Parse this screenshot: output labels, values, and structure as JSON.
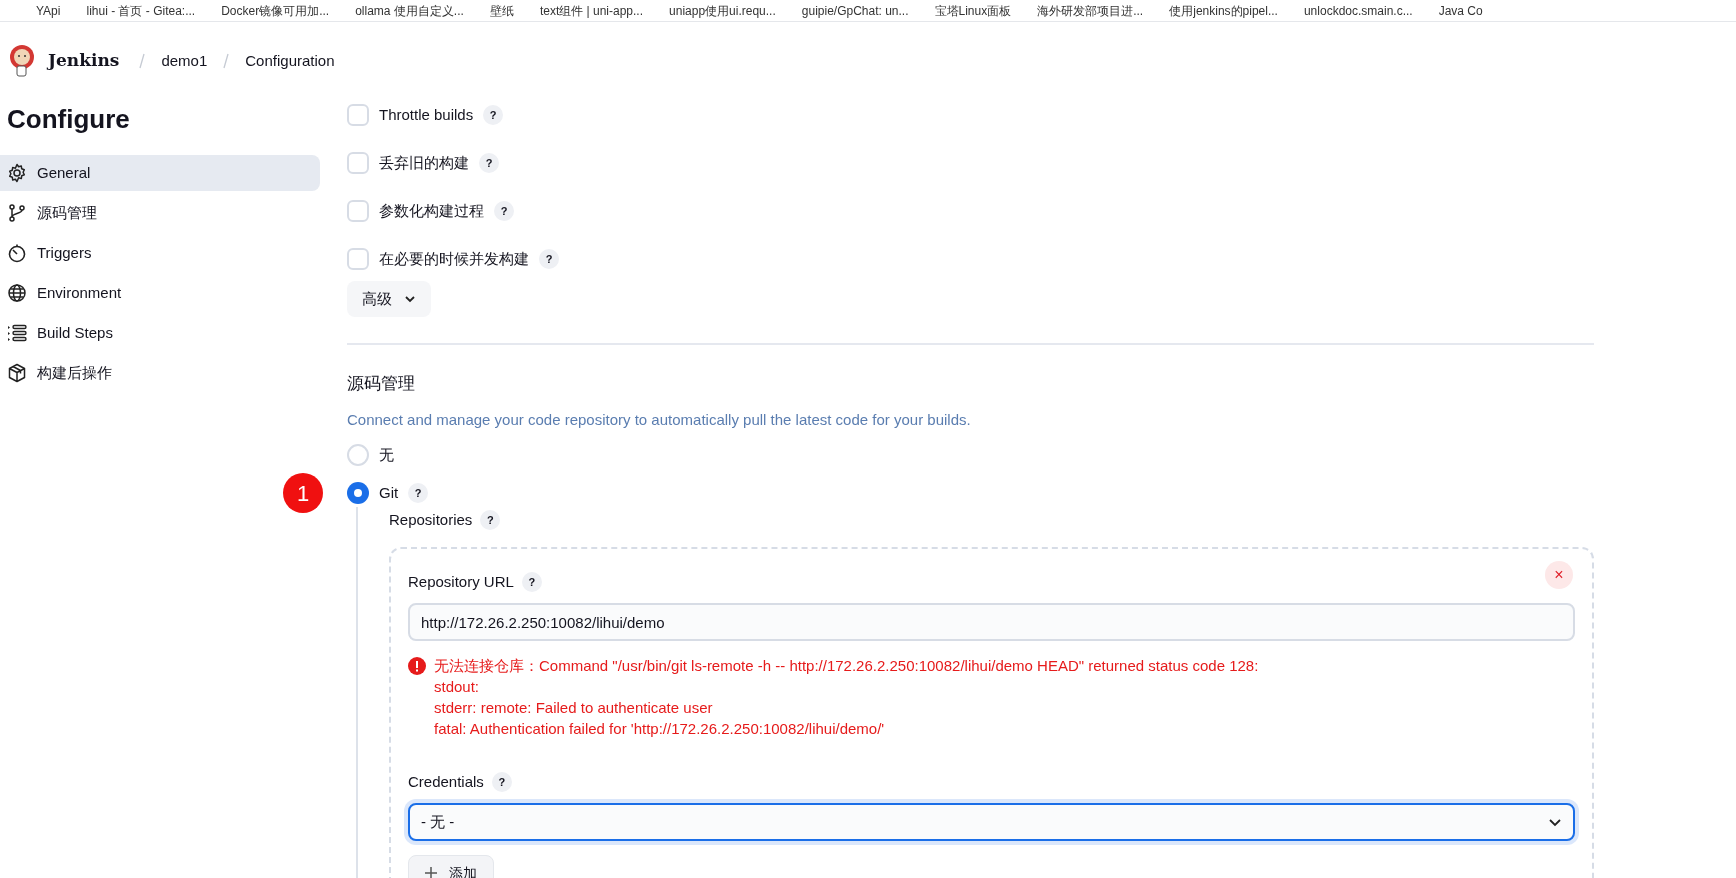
{
  "bookmarks": [
    {
      "label": "YApi"
    },
    {
      "label": "lihui - 首页 - Gitea:..."
    },
    {
      "label": "Docker镜像可用加..."
    },
    {
      "label": "ollama 使用自定义..."
    },
    {
      "label": "壁纸"
    },
    {
      "label": "text组件 | uni-app..."
    },
    {
      "label": "uniapp使用ui.requ..."
    },
    {
      "label": "guipie/GpChat: un..."
    },
    {
      "label": "宝塔Linux面板"
    },
    {
      "label": "海外研发部项目进..."
    },
    {
      "label": "使用jenkins的pipel..."
    },
    {
      "label": "unlockdoc.smain.c..."
    },
    {
      "label": "Java Co"
    }
  ],
  "breadcrumb": {
    "brand": "Jenkins",
    "items": [
      "demo1",
      "Configuration"
    ]
  },
  "sidebar": {
    "title": "Configure",
    "items": [
      {
        "label": "General",
        "kind": "gear",
        "selected": true
      },
      {
        "label": "源码管理",
        "kind": "branch",
        "selected": false
      },
      {
        "label": "Triggers",
        "kind": "timer",
        "selected": false
      },
      {
        "label": "Environment",
        "kind": "globe",
        "selected": false
      },
      {
        "label": "Build Steps",
        "kind": "steps",
        "selected": false
      },
      {
        "label": "构建后操作",
        "kind": "box",
        "selected": false
      }
    ]
  },
  "options": [
    {
      "label": "Throttle builds",
      "checked": false,
      "help": "?"
    },
    {
      "label": "丢弃旧的构建",
      "checked": false,
      "help": "?"
    },
    {
      "label": "参数化构建过程",
      "checked": false,
      "help": "?"
    },
    {
      "label": "在必要的时候并发构建",
      "checked": false,
      "help": "?"
    }
  ],
  "advanced_button": "高级",
  "scm": {
    "title": "源码管理",
    "description": "Connect and manage your code repository to automatically pull the latest code for your builds.",
    "choices": [
      {
        "label": "无",
        "selected": false
      },
      {
        "label": "Git",
        "selected": true,
        "help": "?"
      }
    ],
    "marker": "1",
    "repositories_label": "Repositories",
    "repositories_help": "?",
    "repo_url_label": "Repository URL",
    "repo_url_help": "?",
    "remove": "×",
    "repo_url": "http://172.26.2.250:10082/lihui/demo",
    "error_lines": [
      "无法连接仓库：Command \"/usr/bin/git ls-remote -h -- http://172.26.2.250:10082/lihui/demo HEAD\" returned status code 128:",
      "stdout:",
      "stderr: remote: Failed to authenticate user",
      "fatal: Authentication failed for 'http://172.26.2.250:10082/lihui/demo/'"
    ],
    "credentials_label": "Credentials",
    "credentials_help": "?",
    "credentials_value": "- 无 -",
    "add_button": "添加"
  }
}
